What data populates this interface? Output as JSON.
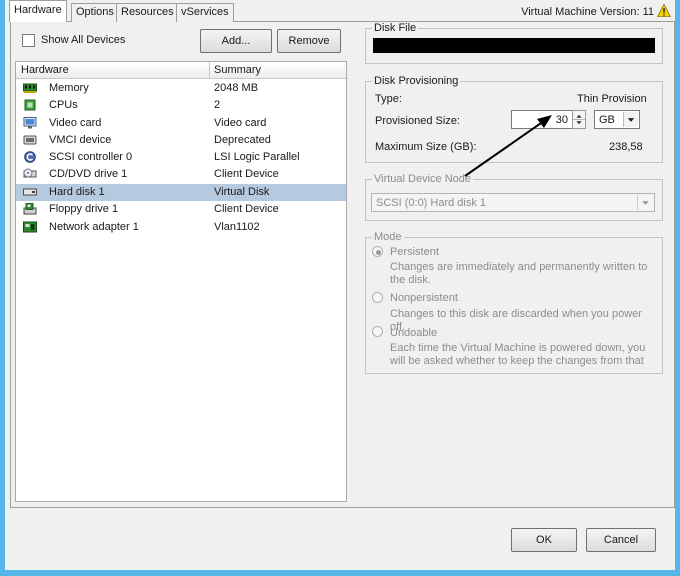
{
  "tabs": [
    {
      "label": "Hardware",
      "active": true
    },
    {
      "label": "Options",
      "active": false
    },
    {
      "label": "Resources",
      "active": false
    },
    {
      "label": "vServices",
      "active": false
    }
  ],
  "vm_version": "Virtual Machine Version: 11",
  "show_all_devices": {
    "label": "Show All Devices",
    "checked": false
  },
  "buttons": {
    "add": "Add...",
    "remove": "Remove",
    "ok": "OK",
    "cancel": "Cancel"
  },
  "device_list": {
    "columns": [
      "Hardware",
      "Summary"
    ],
    "rows": [
      {
        "name": "Memory",
        "summary": "2048 MB",
        "icon": "memory-icon"
      },
      {
        "name": "CPUs",
        "summary": "2",
        "icon": "cpu-icon"
      },
      {
        "name": "Video card",
        "summary": "Video card",
        "icon": "video-card-icon"
      },
      {
        "name": "VMCI device",
        "summary": "Deprecated",
        "icon": "vmci-device-icon"
      },
      {
        "name": "SCSI controller 0",
        "summary": "LSI Logic Parallel",
        "icon": "scsi-controller-icon"
      },
      {
        "name": "CD/DVD drive 1",
        "summary": "Client Device",
        "icon": "cd-dvd-icon"
      },
      {
        "name": "Hard disk 1",
        "summary": "Virtual Disk",
        "icon": "hard-disk-icon",
        "selected": true
      },
      {
        "name": "Floppy drive 1",
        "summary": "Client Device",
        "icon": "floppy-icon"
      },
      {
        "name": "Network adapter 1",
        "summary": "Vlan1102",
        "icon": "network-adapter-icon"
      }
    ]
  },
  "disk_file": {
    "legend": "Disk File",
    "value": ""
  },
  "disk_provisioning": {
    "legend": "Disk Provisioning",
    "type_label": "Type:",
    "type_value": "Thin Provision",
    "size_label": "Provisioned Size:",
    "size_value": "30",
    "size_unit": "GB",
    "max_label": "Maximum Size (GB):",
    "max_value": "238,58"
  },
  "virtual_device_node": {
    "legend": "Virtual Device Node",
    "value": "SCSI (0:0) Hard disk 1"
  },
  "mode": {
    "legend": "Mode",
    "options": [
      {
        "label": "Persistent",
        "desc": "Changes are immediately and permanently written to the disk.",
        "checked": true
      },
      {
        "label": "Nonpersistent",
        "desc": "Changes to this disk are discarded when you power off.",
        "checked": false
      },
      {
        "label": "Undoable",
        "desc": "Each time the Virtual Machine is powered down, you will be asked whether to keep the changes from that",
        "checked": false
      }
    ]
  },
  "colors": {
    "window_frame": "#55b7e8",
    "selection": "#b5c9df",
    "panel": "#f0f0f0",
    "warning": "#f5d300"
  }
}
